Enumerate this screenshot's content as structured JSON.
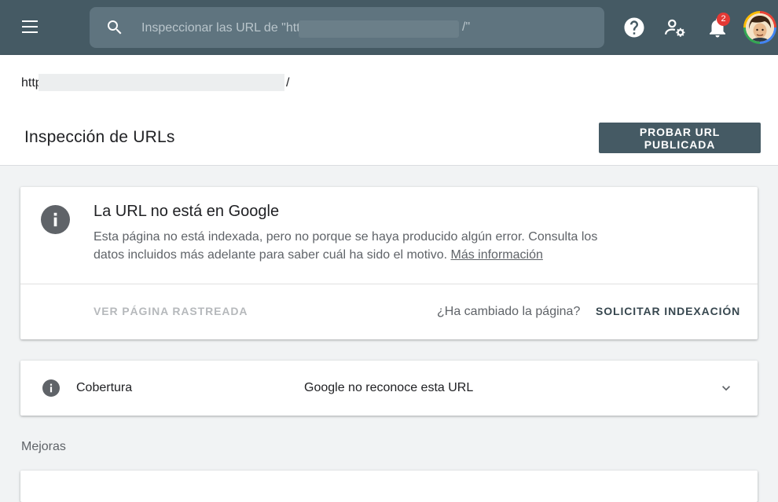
{
  "topbar": {
    "search_placeholder": "Inspeccionar las URL de \"htt",
    "search_suffix": "/\"",
    "notification_count": "2",
    "icons": {
      "menu": "menu-icon",
      "search": "search-icon",
      "help": "help-icon",
      "settings": "manage-accounts-icon",
      "notifications": "bell-icon",
      "account": "avatar"
    }
  },
  "url_strip": {
    "start": "http",
    "end": "/"
  },
  "page": {
    "title": "Inspección de URLs",
    "test_live_label": "PROBAR URL PUBLICADA"
  },
  "status_card": {
    "heading": "La URL no está en Google",
    "description": "Esta página no está indexada, pero no porque se haya producido algún error. Consulta los datos incluidos más adelante para saber cuál ha sido el motivo. ",
    "learn_more": "Más información",
    "view_crawled": "VER PÁGINA RASTREADA",
    "changed_question": "¿Ha cambiado la página?",
    "request_indexing": "SOLICITAR INDEXACIÓN"
  },
  "coverage": {
    "label": "Cobertura",
    "value": "Google no reconoce esta URL"
  },
  "enhancements": {
    "title": "Mejoras"
  },
  "colors": {
    "topbar": "#455a64",
    "background": "#f1f3f4",
    "primary_button": "#455a64",
    "badge": "#e53935"
  }
}
